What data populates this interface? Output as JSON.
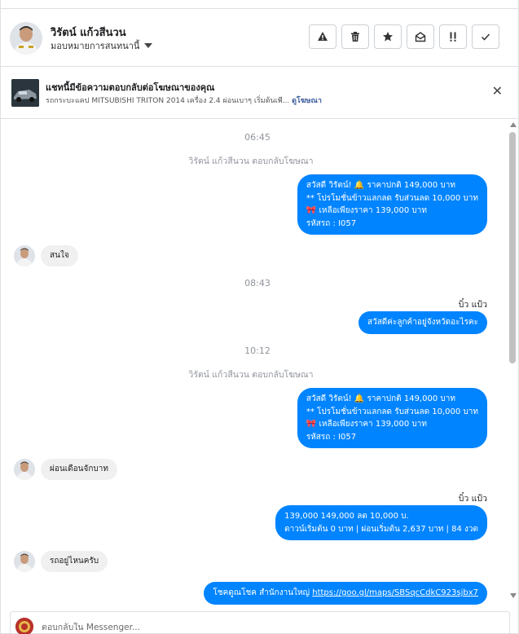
{
  "header": {
    "name": "วิรัตน์ แก้วสีนวน",
    "assign_label": "มอบหมายการสนทนานี้",
    "toolbar": [
      {
        "name": "report-spam-button",
        "icon": "warning-icon",
        "glyph": "⚠"
      },
      {
        "name": "delete-button",
        "icon": "trash-icon",
        "glyph": "🗑"
      },
      {
        "name": "star-button",
        "icon": "star-icon",
        "glyph": "★"
      },
      {
        "name": "mark-unread-button",
        "icon": "envelope-open-icon",
        "glyph": "✉"
      },
      {
        "name": "follow-up-button",
        "icon": "exclamation-icon",
        "glyph": "!!"
      },
      {
        "name": "mark-done-button",
        "icon": "checkmark-icon",
        "glyph": "✓"
      }
    ]
  },
  "ad": {
    "title": "แชทนี้มีข้อความตอบกลับต่อโฆษณาของคุณ",
    "subtitle": "รถกระบะแคป MITSUBISHI TRITON 2014 เครื่อง 2.4 ผ่อนเบาๆ เริ่มต้นเพี...",
    "link": "ดูโฆษณา",
    "close_glyph": "✕"
  },
  "messages": {
    "time1": "06:45",
    "sys1": "วิรัตน์ แก้วสีนวน ตอบกลับโฆษณา",
    "out1": [
      "สวัสดี วิรัตน์! 🔔 ราคาปกติ 149,000 บาท",
      "** โปรโมชั่นข้าวแลกลด รับส่วนลด 10,000 บาท",
      "🎀 เหลือเพียงราคา 139,000 บาท",
      "รหัสรถ : I057"
    ],
    "in1": "สนใจ",
    "time2": "08:43",
    "sender1": "บิ๋ว แป้ว",
    "out2": "สวัสดีค่ะลูกค้าอยู่จังหวัดอะไรคะ",
    "time3": "10:12",
    "sys2": "วิรัตน์ แก้วสีนวน ตอบกลับโฆษณา",
    "out3": [
      "สวัสดี วิรัตน์! 🔔 ราคาปกติ 149,000 บาท",
      "** โปรโมชั่นข้าวแลกลด รับส่วนลด 10,000 บาท",
      "🎀 เหลือเพียงราคา 139,000 บาท",
      "รหัสรถ : I057"
    ],
    "in2": "ผ่อนเดือนจักบาท",
    "sender2": "บิ๋ว แป้ว",
    "out4": [
      "139,000 149,000 ลด 10,000 บ.",
      "ดาวน์เริ่มต้น 0 บาท | ผ่อนเริ่มต้น 2,637 บาท | 84 งวด"
    ],
    "in3": "รถอยู่ไหนครับ",
    "out5_prefix": "โชคดูณโชค สำนักงานใหญ่ ",
    "out5_link": "https://goo.gl/maps/SBSqcCdkC923sjbx7"
  },
  "composer": {
    "placeholder": "ตอบกลับใน Messenger..."
  },
  "colors": {
    "accent": "#0084ff",
    "incoming": "#f1f0f0",
    "link": "#365899"
  }
}
